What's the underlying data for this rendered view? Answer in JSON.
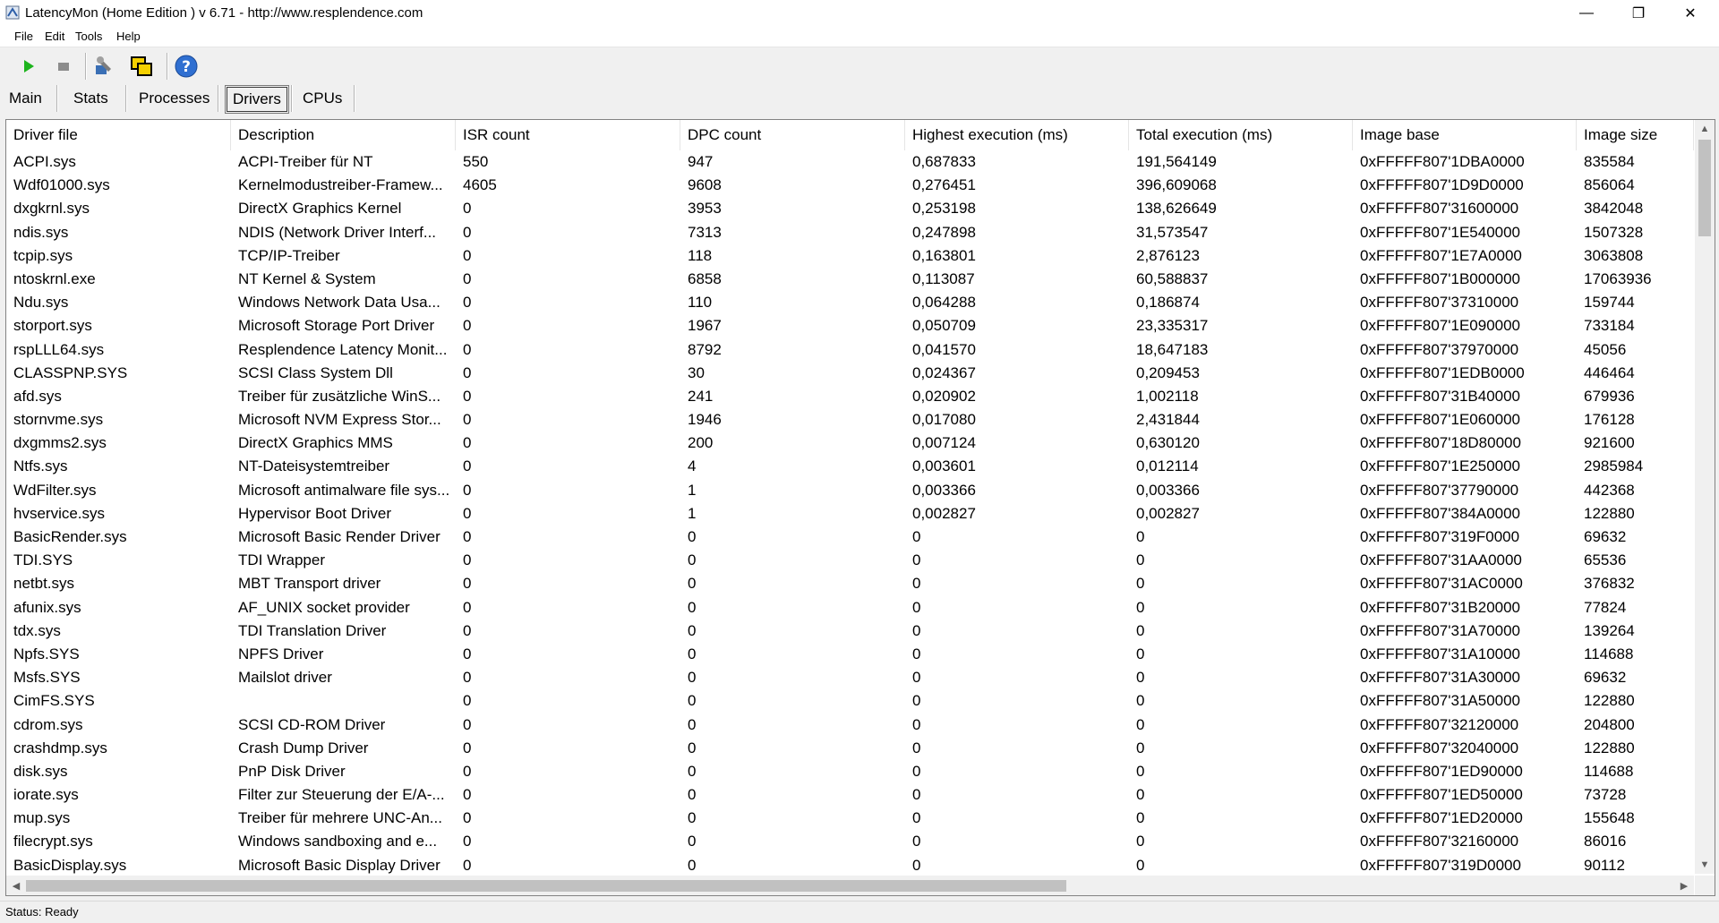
{
  "window": {
    "title": "LatencyMon  (Home Edition )  v 6.71 - http://www.resplendence.com",
    "minimize": "—",
    "maximize": "❐",
    "close": "✕"
  },
  "menu": [
    {
      "label": "File"
    },
    {
      "label": "Edit"
    },
    {
      "label": "Tools"
    },
    {
      "label": "Help"
    }
  ],
  "toolbar": {
    "start_icon": "play-icon",
    "stop_icon": "stop-icon",
    "tools_icon": "tools-icon",
    "windows_icon": "windows-icon",
    "help_icon": "help-icon"
  },
  "tabs": [
    {
      "label": "Main"
    },
    {
      "label": "Stats"
    },
    {
      "label": "Processes"
    },
    {
      "label": "Drivers",
      "active": true
    },
    {
      "label": "CPUs"
    }
  ],
  "table": {
    "columns": [
      "Driver file",
      "Description",
      "ISR count",
      "DPC count",
      "Highest execution (ms)",
      "Total execution (ms)",
      "Image base",
      "Image size"
    ],
    "rows": [
      [
        "ACPI.sys",
        "ACPI-Treiber für NT",
        "550",
        "947",
        "0,687833",
        "191,564149",
        "0xFFFFF807'1DBA0000",
        "835584"
      ],
      [
        "Wdf01000.sys",
        "Kernelmodustreiber-Framew...",
        "4605",
        "9608",
        "0,276451",
        "396,609068",
        "0xFFFFF807'1D9D0000",
        "856064"
      ],
      [
        "dxgkrnl.sys",
        "DirectX Graphics Kernel",
        "0",
        "3953",
        "0,253198",
        "138,626649",
        "0xFFFFF807'31600000",
        "3842048"
      ],
      [
        "ndis.sys",
        "NDIS (Network Driver Interf...",
        "0",
        "7313",
        "0,247898",
        "31,573547",
        "0xFFFFF807'1E540000",
        "1507328"
      ],
      [
        "tcpip.sys",
        "TCP/IP-Treiber",
        "0",
        "118",
        "0,163801",
        "2,876123",
        "0xFFFFF807'1E7A0000",
        "3063808"
      ],
      [
        "ntoskrnl.exe",
        "NT Kernel & System",
        "0",
        "6858",
        "0,113087",
        "60,588837",
        "0xFFFFF807'1B000000",
        "17063936"
      ],
      [
        "Ndu.sys",
        "Windows Network Data Usa...",
        "0",
        "110",
        "0,064288",
        "0,186874",
        "0xFFFFF807'37310000",
        "159744"
      ],
      [
        "storport.sys",
        "Microsoft Storage Port Driver",
        "0",
        "1967",
        "0,050709",
        "23,335317",
        "0xFFFFF807'1E090000",
        "733184"
      ],
      [
        "rspLLL64.sys",
        "Resplendence Latency Monit...",
        "0",
        "8792",
        "0,041570",
        "18,647183",
        "0xFFFFF807'37970000",
        "45056"
      ],
      [
        "CLASSPNP.SYS",
        "SCSI Class System Dll",
        "0",
        "30",
        "0,024367",
        "0,209453",
        "0xFFFFF807'1EDB0000",
        "446464"
      ],
      [
        "afd.sys",
        "Treiber für zusätzliche WinS...",
        "0",
        "241",
        "0,020902",
        "1,002118",
        "0xFFFFF807'31B40000",
        "679936"
      ],
      [
        "stornvme.sys",
        "Microsoft NVM Express Stor...",
        "0",
        "1946",
        "0,017080",
        "2,431844",
        "0xFFFFF807'1E060000",
        "176128"
      ],
      [
        "dxgmms2.sys",
        "DirectX Graphics MMS",
        "0",
        "200",
        "0,007124",
        "0,630120",
        "0xFFFFF807'18D80000",
        "921600"
      ],
      [
        "Ntfs.sys",
        "NT-Dateisystemtreiber",
        "0",
        "4",
        "0,003601",
        "0,012114",
        "0xFFFFF807'1E250000",
        "2985984"
      ],
      [
        "WdFilter.sys",
        "Microsoft antimalware file sys...",
        "0",
        "1",
        "0,003366",
        "0,003366",
        "0xFFFFF807'37790000",
        "442368"
      ],
      [
        "hvservice.sys",
        "Hypervisor Boot Driver",
        "0",
        "1",
        "0,002827",
        "0,002827",
        "0xFFFFF807'384A0000",
        "122880"
      ],
      [
        "BasicRender.sys",
        "Microsoft Basic Render Driver",
        "0",
        "0",
        "0",
        "0",
        "0xFFFFF807'319F0000",
        "69632"
      ],
      [
        "TDI.SYS",
        "TDI Wrapper",
        "0",
        "0",
        "0",
        "0",
        "0xFFFFF807'31AA0000",
        "65536"
      ],
      [
        "netbt.sys",
        "MBT Transport driver",
        "0",
        "0",
        "0",
        "0",
        "0xFFFFF807'31AC0000",
        "376832"
      ],
      [
        "afunix.sys",
        "AF_UNIX socket provider",
        "0",
        "0",
        "0",
        "0",
        "0xFFFFF807'31B20000",
        "77824"
      ],
      [
        "tdx.sys",
        "TDI Translation Driver",
        "0",
        "0",
        "0",
        "0",
        "0xFFFFF807'31A70000",
        "139264"
      ],
      [
        "Npfs.SYS",
        "NPFS Driver",
        "0",
        "0",
        "0",
        "0",
        "0xFFFFF807'31A10000",
        "114688"
      ],
      [
        "Msfs.SYS",
        "Mailslot driver",
        "0",
        "0",
        "0",
        "0",
        "0xFFFFF807'31A30000",
        "69632"
      ],
      [
        "CimFS.SYS",
        "",
        "0",
        "0",
        "0",
        "0",
        "0xFFFFF807'31A50000",
        "122880"
      ],
      [
        "cdrom.sys",
        "SCSI CD-ROM Driver",
        "0",
        "0",
        "0",
        "0",
        "0xFFFFF807'32120000",
        "204800"
      ],
      [
        "crashdmp.sys",
        "Crash Dump Driver",
        "0",
        "0",
        "0",
        "0",
        "0xFFFFF807'32040000",
        "122880"
      ],
      [
        "disk.sys",
        "PnP Disk Driver",
        "0",
        "0",
        "0",
        "0",
        "0xFFFFF807'1ED90000",
        "114688"
      ],
      [
        "iorate.sys",
        "Filter zur Steuerung der E/A-...",
        "0",
        "0",
        "0",
        "0",
        "0xFFFFF807'1ED50000",
        "73728"
      ],
      [
        "mup.sys",
        "Treiber für mehrere UNC-An...",
        "0",
        "0",
        "0",
        "0",
        "0xFFFFF807'1ED20000",
        "155648"
      ],
      [
        "filecrypt.sys",
        "Windows sandboxing and e...",
        "0",
        "0",
        "0",
        "0",
        "0xFFFFF807'32160000",
        "86016"
      ],
      [
        "BasicDisplay.sys",
        "Microsoft Basic Display Driver",
        "0",
        "0",
        "0",
        "0",
        "0xFFFFF807'319D0000",
        "90112"
      ]
    ]
  },
  "scroll": {
    "up": "▲",
    "down": "▼",
    "left": "◀",
    "right": "▶"
  },
  "status": {
    "text": "Status: Ready"
  }
}
